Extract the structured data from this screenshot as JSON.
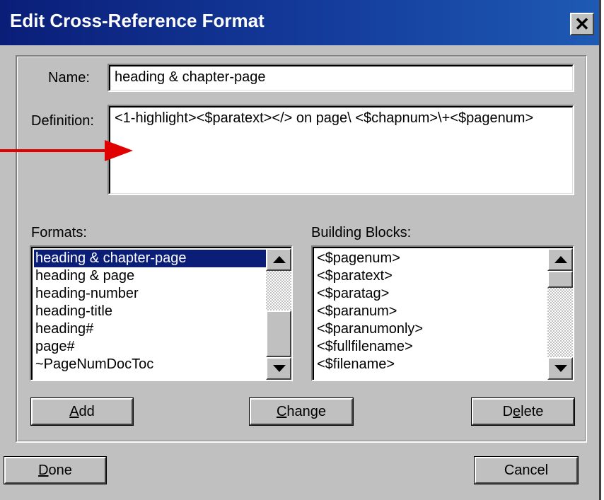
{
  "window": {
    "title": "Edit Cross-Reference Format",
    "close_glyph": "✕"
  },
  "name_field": {
    "label": "Name:",
    "value": "heading & chapter-page"
  },
  "definition_field": {
    "label": "Definition:",
    "value": "<1-highlight><$paratext></> on page\\ <$chapnum>\\+<$pagenum>"
  },
  "formats": {
    "label": "Formats:",
    "selected_index": 0,
    "items": [
      "heading & chapter-page",
      "heading & page",
      "heading-number",
      "heading-title",
      "heading#",
      "page#",
      "~PageNumDocToc"
    ]
  },
  "building_blocks": {
    "label": "Building Blocks:",
    "items": [
      "<$pagenum>",
      "<$paratext>",
      "<$paratag>",
      "<$paranum>",
      "<$paranumonly>",
      "<$fullfilename>",
      "<$filename>"
    ]
  },
  "buttons": {
    "add": {
      "mnemonic": "A",
      "rest": "dd"
    },
    "change": {
      "mnemonic": "C",
      "rest": "hange"
    },
    "delete": {
      "pre": "D",
      "mnemonic": "e",
      "rest": "lete"
    },
    "done": {
      "mnemonic": "D",
      "rest": "one"
    },
    "cancel": {
      "label": "Cancel"
    }
  },
  "colors": {
    "annotation_arrow": "#e00000",
    "selection": "#0a1e78",
    "titlebar": "#0a1e78"
  }
}
